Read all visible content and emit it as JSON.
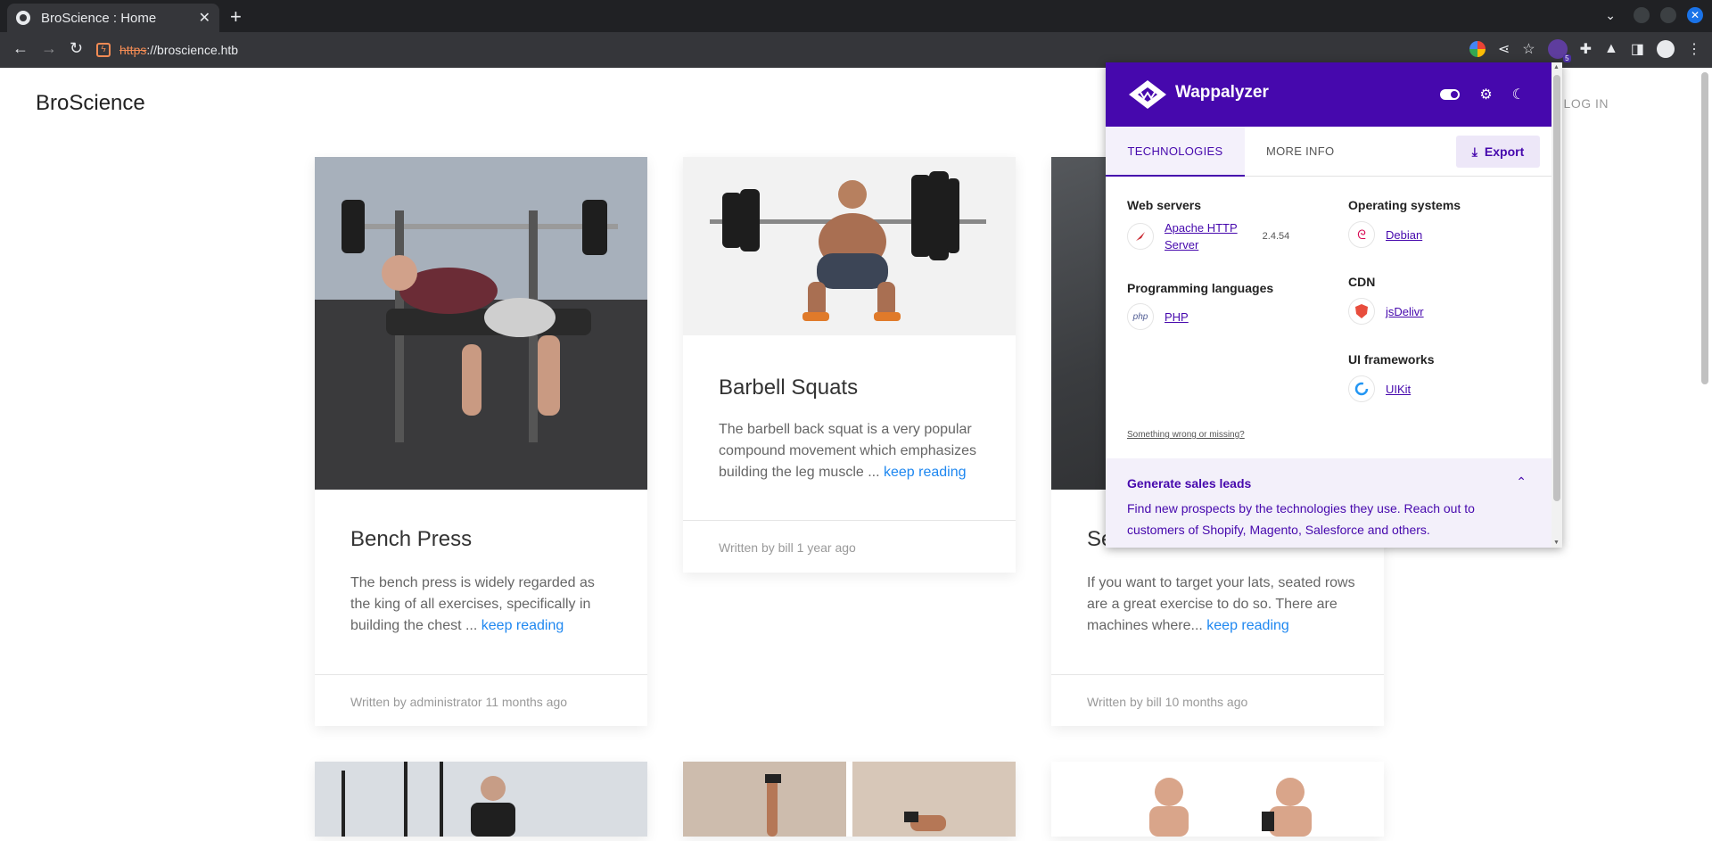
{
  "browser": {
    "tab_title": "BroScience : Home",
    "tab_close": "✕",
    "new_tab": "+",
    "url_scheme": "https",
    "url_rest": "://broscience.htb",
    "extension_badge": "5"
  },
  "site": {
    "brand": "BroScience",
    "login": "LOG IN"
  },
  "cards": [
    {
      "title": "Bench Press",
      "excerpt": "The bench press is widely regarded as the king of all exercises, specifically in building the chest ... ",
      "link": "keep reading",
      "footer": "Written by administrator 11 months ago"
    },
    {
      "title": "Barbell Squats",
      "excerpt": "The barbell back squat is a very popular compound movement which emphasizes building the leg muscle ... ",
      "link": "keep reading",
      "footer": "Written by bill 1 year ago"
    },
    {
      "title": "Se",
      "excerpt": "If you want to target your lats, seated rows are a great exercise to do so. There are machines where... ",
      "link": "keep reading",
      "footer": "Written by bill 10 months ago"
    }
  ],
  "wappalyzer": {
    "name": "Wappalyzer",
    "tabs": [
      "TECHNOLOGIES",
      "MORE INFO"
    ],
    "export_label": "Export",
    "categories": {
      "web_servers": {
        "label": "Web servers",
        "tech": "Apache HTTP Server",
        "tech_line1": "Apache HTTP",
        "tech_line2": "Server",
        "version": "2.4.54"
      },
      "programming": {
        "label": "Programming languages",
        "tech": "PHP",
        "icon_text": "php"
      },
      "os": {
        "label": "Operating systems",
        "tech": "Debian"
      },
      "cdn": {
        "label": "CDN",
        "tech": "jsDelivr"
      },
      "ui": {
        "label": "UI frameworks",
        "tech": "UIKit"
      }
    },
    "wrong_link": "Something wrong or missing?",
    "leads_title": "Generate sales leads",
    "leads_text": "Find new prospects by the technologies they use. Reach out to customers of Shopify, Magento, Salesforce and others.",
    "accent": "#4608ad"
  }
}
